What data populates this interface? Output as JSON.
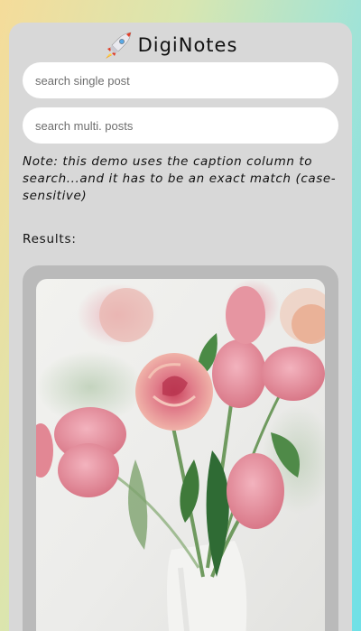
{
  "app": {
    "title": "DigiNotes",
    "logo_icon": "rocket-icon"
  },
  "search": {
    "single_placeholder": "search single post",
    "multi_placeholder": "search multi. posts"
  },
  "note": "Note: this demo uses the caption column to search...and it has to be an exact match (case-sensitive)",
  "results": {
    "label": "Results:"
  },
  "colors": {
    "card_bg": "#d8d8d8",
    "result_card_bg": "#bababa",
    "input_bg": "#ffffff"
  }
}
